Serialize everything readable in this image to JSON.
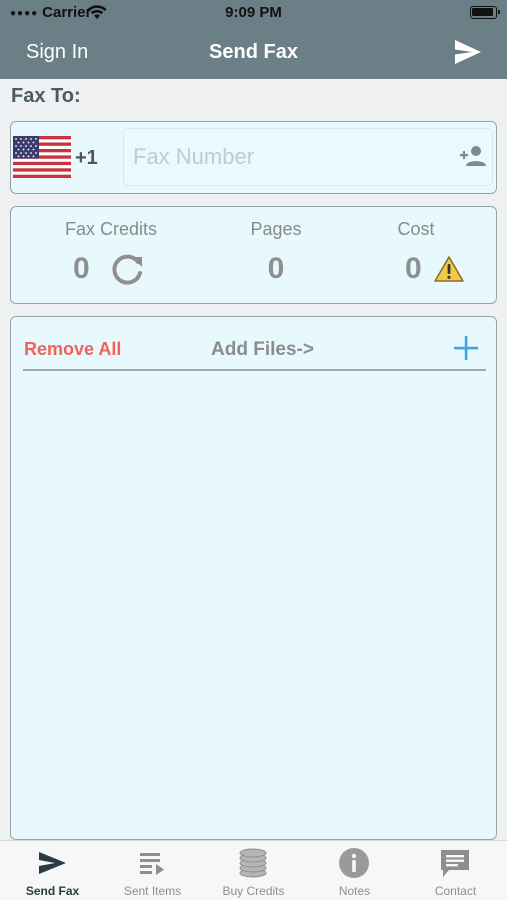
{
  "status_bar": {
    "carrier": "Carrier",
    "time": "9:09 PM"
  },
  "nav": {
    "left_button": "Sign In",
    "title": "Send Fax",
    "right_icon": "send-icon"
  },
  "fax_to": {
    "label": "Fax To:",
    "country_flag": "us-flag-icon",
    "country_code": "+1",
    "fax_number_value": "",
    "fax_number_placeholder": "Fax Number",
    "contact_icon": "add-person-icon"
  },
  "stats": {
    "fax_credits": {
      "label": "Fax Credits",
      "value": "0",
      "icon": "refresh-icon"
    },
    "pages": {
      "label": "Pages",
      "value": "0"
    },
    "cost": {
      "label": "Cost",
      "value": "0",
      "icon": "warning-icon"
    }
  },
  "files": {
    "remove_all": "Remove All",
    "add_files": "Add Files->",
    "add_icon": "plus-icon"
  },
  "tabbar": {
    "active_index": 0,
    "items": [
      {
        "label": "Send Fax",
        "icon": "send-icon"
      },
      {
        "label": "Sent Items",
        "icon": "list-icon"
      },
      {
        "label": "Buy Credits",
        "icon": "coins-icon"
      },
      {
        "label": "Notes",
        "icon": "info-icon"
      },
      {
        "label": "Contact",
        "icon": "chat-icon"
      }
    ]
  },
  "colors": {
    "nav_bar": "#6b7f87",
    "panel_background": "#e7f9fd",
    "remove_all": "#f0625a",
    "add_icon": "#3aa6e8",
    "warning": "#f2c94c"
  }
}
